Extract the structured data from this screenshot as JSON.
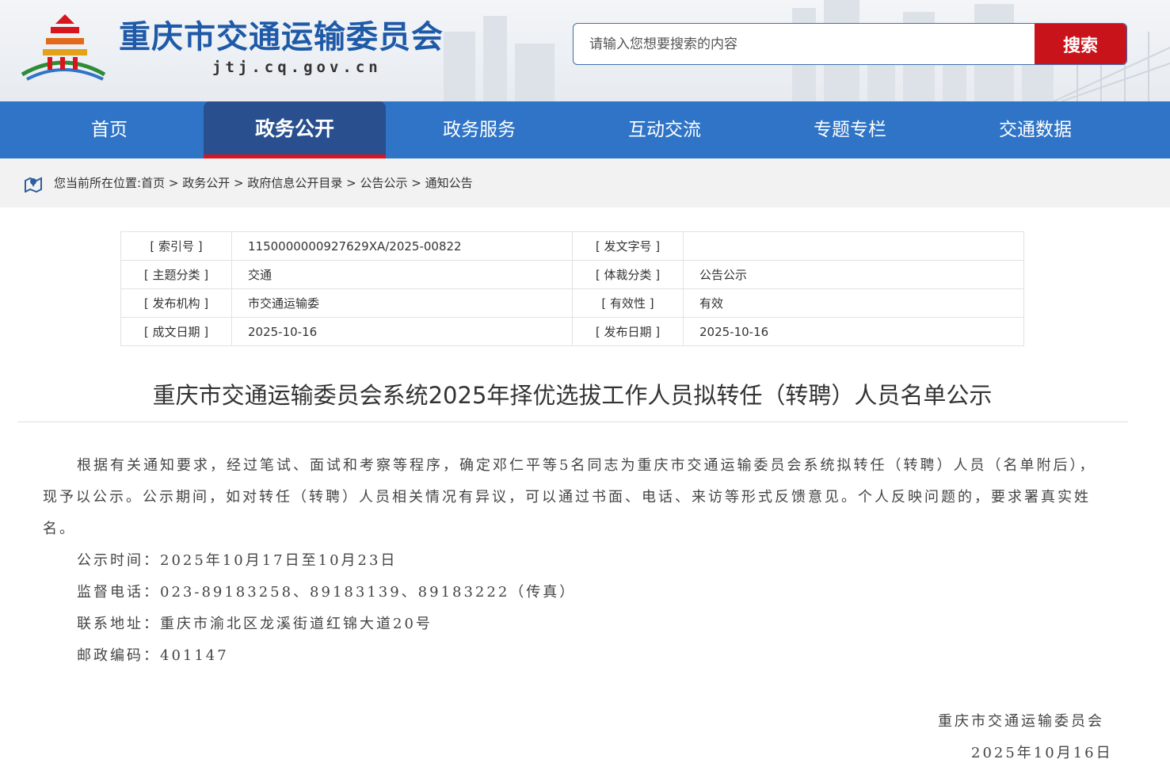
{
  "header": {
    "site_title": "重庆市交通运输委员会",
    "site_domain": "jtj.cq.gov.cn",
    "search_placeholder": "请输入您想要搜索的内容",
    "search_button": "搜索"
  },
  "nav": {
    "items": [
      "首页",
      "政务公开",
      "政务服务",
      "互动交流",
      "专题专栏",
      "交通数据"
    ],
    "active_index": 1
  },
  "breadcrumb": {
    "prefix": "您当前所在位置:",
    "items": [
      "首页",
      "政务公开",
      "政府信息公开目录",
      "公告公示",
      "通知公告"
    ],
    "separator": " > "
  },
  "meta": {
    "rows": [
      {
        "k1": "[ 索引号 ]",
        "v1": "1150000000927629XA/2025-00822",
        "k2": "[ 发文字号 ]",
        "v2": ""
      },
      {
        "k1": "[ 主题分类 ]",
        "v1": "交通",
        "k2": "[ 体裁分类 ]",
        "v2": "公告公示"
      },
      {
        "k1": "[ 发布机构 ]",
        "v1": "市交通运输委",
        "k2": "[ 有效性 ]",
        "v2": "有效"
      },
      {
        "k1": "[ 成文日期 ]",
        "v1": "2025-10-16",
        "k2": "[ 发布日期 ]",
        "v2": "2025-10-16"
      }
    ]
  },
  "article": {
    "title": "重庆市交通运输委员会系统2025年择优选拔工作人员拟转任（转聘）人员名单公示",
    "lead": "根据有关通知要求，经过笔试、面试和考察等程序，确定邓仁平等5名同志为重庆市交通运输委员会系统拟转任（转聘）人员（名单附后），现予以公示。公示期间，如对转任（转聘）人员相关情况有异议，可以通过书面、电话、来访等形式反馈意见。个人反映问题的，要求署真实姓名。",
    "items": [
      "公示时间：2025年10月17日至10月23日",
      "监督电话：023-89183258、89183139、89183222（传真）",
      "联系地址：重庆市渝北区龙溪街道红锦大道20号",
      "邮政编码：401147"
    ],
    "signature": "重庆市交通运输委员会",
    "date": "2025年10月16日"
  },
  "colors": {
    "brand_blue": "#2f74c7",
    "nav_active": "#2a4f8f",
    "accent_red": "#c8131a",
    "title_blue": "#1f5aa8"
  }
}
